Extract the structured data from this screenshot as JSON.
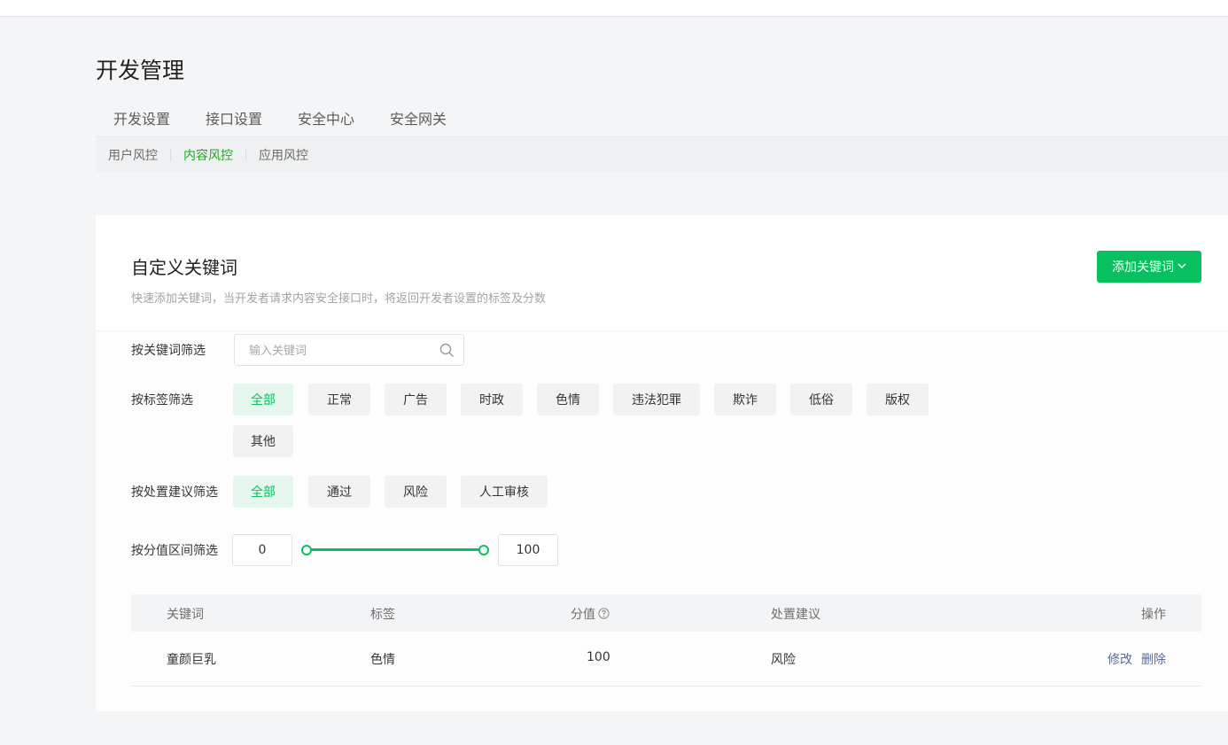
{
  "header": {
    "title": "开发管理"
  },
  "main_tabs": [
    {
      "label": "开发设置"
    },
    {
      "label": "接口设置"
    },
    {
      "label": "安全中心"
    },
    {
      "label": "安全网关"
    }
  ],
  "sub_tabs": [
    {
      "label": "用户风控",
      "active": false
    },
    {
      "label": "内容风控",
      "active": true
    },
    {
      "label": "应用风控",
      "active": false
    }
  ],
  "card": {
    "title": "自定义关键词",
    "description": "快速添加关键词，当开发者请求内容安全接口时，将返回开发者设置的标签及分数",
    "add_button": "添加关键词"
  },
  "filters": {
    "keyword": {
      "label": "按关键词筛选",
      "placeholder": "输入关键词",
      "value": ""
    },
    "tag": {
      "label": "按标签筛选",
      "options": [
        "全部",
        "正常",
        "广告",
        "时政",
        "色情",
        "违法犯罪",
        "欺诈",
        "低俗",
        "版权",
        "其他"
      ],
      "selected": "全部"
    },
    "suggestion": {
      "label": "按处置建议筛选",
      "options": [
        "全部",
        "通过",
        "风险",
        "人工审核"
      ],
      "selected": "全部"
    },
    "score": {
      "label": "按分值区间筛选",
      "min": "0",
      "max": "100"
    }
  },
  "table": {
    "columns": [
      "关键词",
      "标签",
      "分值",
      "处置建议",
      "操作"
    ],
    "rows": [
      {
        "keyword": "童颜巨乳",
        "tag": "色情",
        "score": "100",
        "suggestion": "风险",
        "actions": [
          "修改",
          "删除"
        ]
      }
    ]
  },
  "colors": {
    "accent": "#07c160",
    "link": "#576b95"
  },
  "icons": {
    "search": "search-icon",
    "help": "help-circle-icon",
    "dropdown": "chevron-down-icon"
  }
}
